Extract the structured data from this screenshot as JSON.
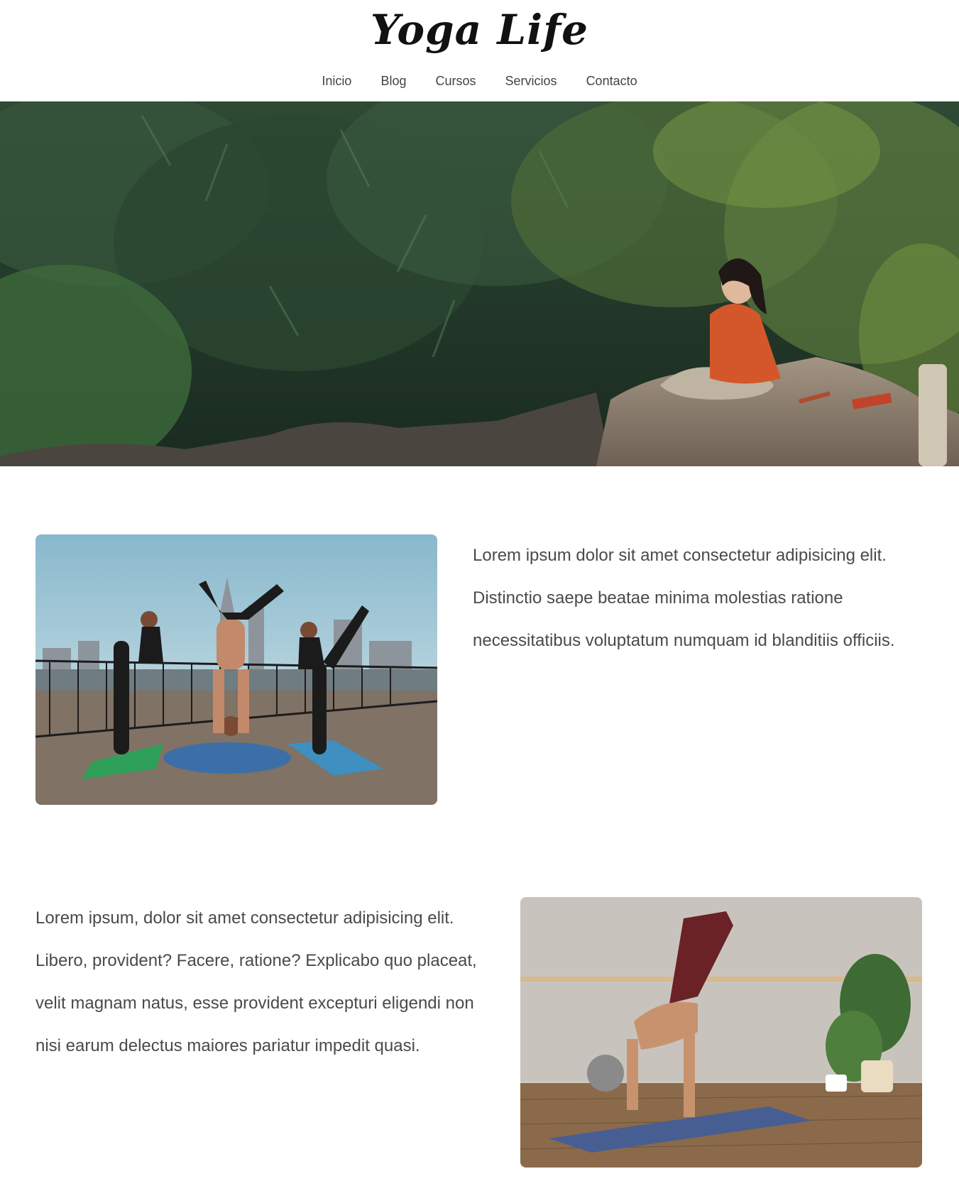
{
  "header": {
    "logo": "Yoga Life",
    "nav": [
      "Inicio",
      "Blog",
      "Cursos",
      "Servicios",
      "Contacto"
    ]
  },
  "hero": {
    "image": "woman-meditating-on-rock-in-forest"
  },
  "sections": [
    {
      "image": "three-people-doing-yoga-poses-on-riverside",
      "text": "Lorem ipsum dolor sit amet consectetur adipisicing elit. Distinctio saepe beatae minima molestias ratione necessitatibus voluptatum numquam id blanditiis officiis."
    },
    {
      "text": "Lorem ipsum, dolor sit amet consectetur adipisicing elit. Libero, provident? Facere, ratione? Explicabo quo placeat, velit magnam natus, esse provident excepturi eligendi non nisi earum delectus maiores pariatur impedit quasi.",
      "image": "man-doing-arm-balance-on-yoga-mat"
    }
  ],
  "colors": {
    "text": "#4a4a4a",
    "logo": "#111111",
    "background": "#ffffff"
  }
}
